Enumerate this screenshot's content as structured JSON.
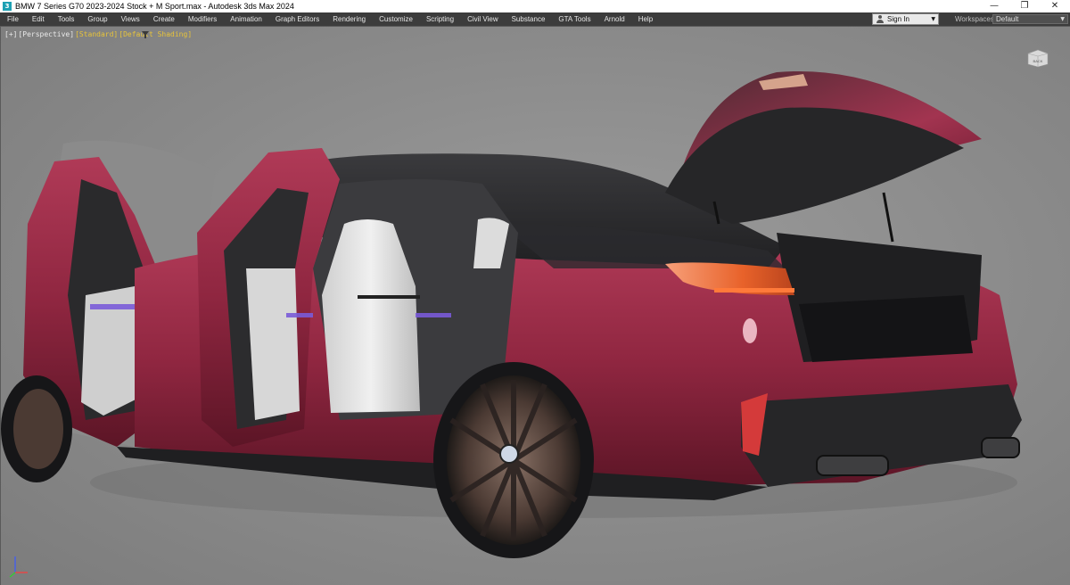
{
  "window": {
    "title": "BMW 7 Series G70 2023-2024 Stock + M Sport.max - Autodesk 3ds Max 2024",
    "controls": {
      "minimize": "—",
      "restore": "❐",
      "close": "✕"
    }
  },
  "menu": {
    "items": [
      "File",
      "Edit",
      "Tools",
      "Group",
      "Views",
      "Create",
      "Modifiers",
      "Animation",
      "Graph Editors",
      "Rendering",
      "Customize",
      "Scripting",
      "Civil View",
      "Substance",
      "GTA Tools",
      "Arnold",
      "Help"
    ]
  },
  "account": {
    "signin_label": "Sign In"
  },
  "workspaces": {
    "label": "Workspaces:",
    "value": "Default"
  },
  "viewport": {
    "label_parts": [
      "[+]",
      "[Perspective]",
      "[Standard]",
      "[Default Shading]"
    ],
    "viewcube_label": "BACK"
  },
  "colors": {
    "menubar_bg": "#3c3c3c",
    "viewport_bg": "#8a8a8a",
    "car_body": "#8f2640",
    "car_dark": "#2b2b2e",
    "interior_seat": "#e2e2e2",
    "taillight": "#e8622a",
    "ambient_light": "#7a5bd8"
  }
}
